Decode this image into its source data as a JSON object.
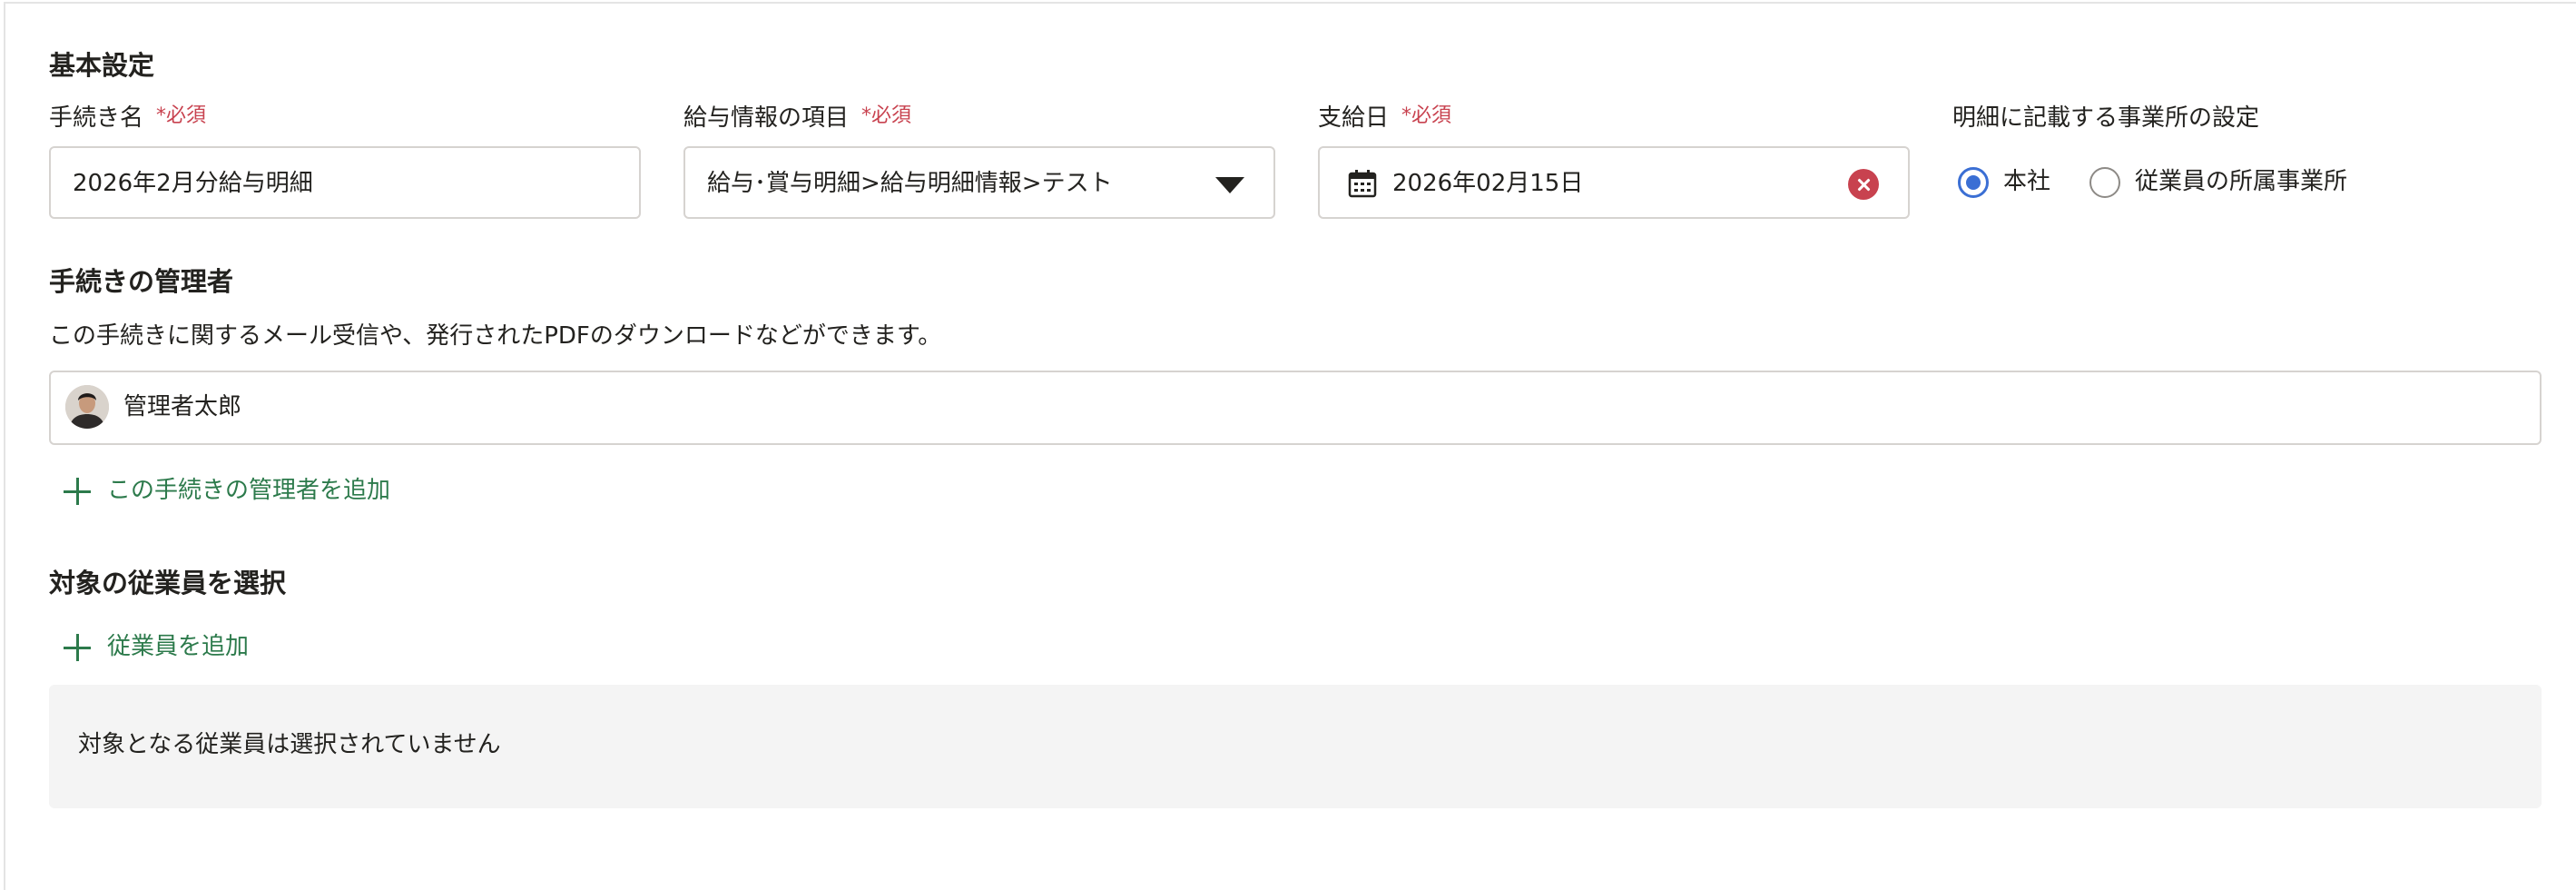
{
  "basic_settings": {
    "title": "基本設定",
    "procedure_name": {
      "label": "手続き名",
      "required": "*必須",
      "value": "2026年2月分給与明細"
    },
    "salary_item": {
      "label": "給与情報の項目",
      "required": "*必須",
      "value": "給与･賞与明細>給与明細情報>テスト"
    },
    "payment_date": {
      "label": "支給日",
      "required": "*必須",
      "value": "2026年02月15日"
    },
    "office_setting": {
      "label": "明細に記載する事業所の設定",
      "options": [
        {
          "label": "本社",
          "checked": true
        },
        {
          "label": "従業員の所属事業所",
          "checked": false
        }
      ]
    }
  },
  "admins": {
    "title": "手続きの管理者",
    "description": "この手続きに関するメール受信や、発行されたPDFのダウンロードなどができます。",
    "items": [
      {
        "name": "管理者太郎"
      }
    ],
    "add_label": "この手続きの管理者を追加"
  },
  "employees": {
    "title": "対象の従業員を選択",
    "add_label": "従業員を追加",
    "empty_text": "対象となる従業員は選択されていません"
  },
  "colors": {
    "required": "#c8424f",
    "link": "#2c7a4b",
    "radio_selected": "#3b6fd4"
  }
}
